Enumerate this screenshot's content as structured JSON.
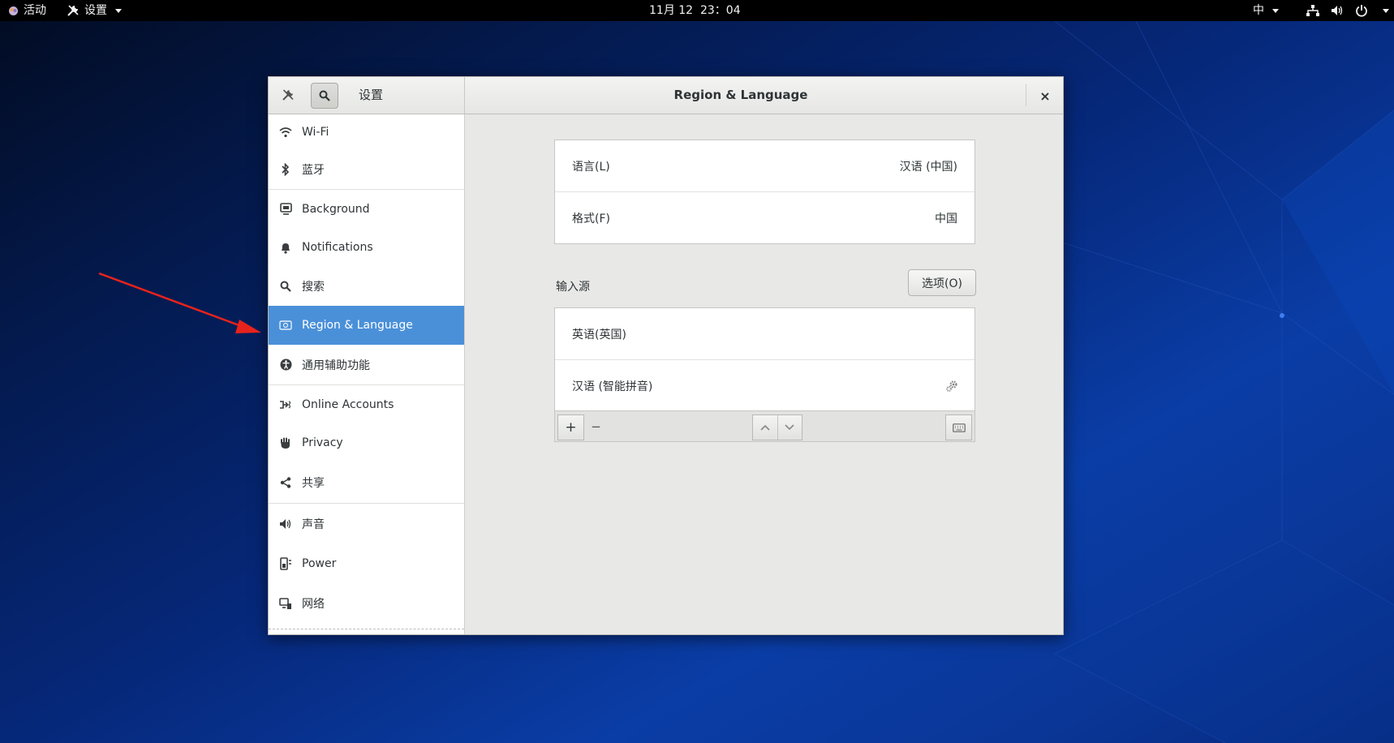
{
  "topbar": {
    "activities": "活动",
    "app_menu": "设置",
    "clock": "11月 12  23：04",
    "input_method": "中"
  },
  "window": {
    "sidebar_title": "设置",
    "page_title": "Region & Language",
    "close": "×"
  },
  "sidebar": {
    "items": [
      {
        "label": "Wi-Fi",
        "icon": "wifi-icon"
      },
      {
        "label": "蓝牙",
        "icon": "bluetooth-icon"
      },
      {
        "label": "Background",
        "icon": "background-icon"
      },
      {
        "label": "Notifications",
        "icon": "bell-icon"
      },
      {
        "label": "搜索",
        "icon": "search-icon"
      },
      {
        "label": "Region & Language",
        "icon": "region-icon",
        "active": true
      },
      {
        "label": "通用辅助功能",
        "icon": "accessibility-icon"
      },
      {
        "label": "Online Accounts",
        "icon": "online-accounts-icon"
      },
      {
        "label": "Privacy",
        "icon": "hand-icon"
      },
      {
        "label": "共享",
        "icon": "share-icon"
      },
      {
        "label": "声音",
        "icon": "speaker-icon"
      },
      {
        "label": "Power",
        "icon": "power-icon"
      },
      {
        "label": "网络",
        "icon": "network-icon"
      }
    ]
  },
  "region": {
    "language_label": "语言(L)",
    "language_value": "汉语 (中国)",
    "formats_label": "格式(F)",
    "formats_value": "中国",
    "input_sources_title": "输入源",
    "options_button": "选项(O)",
    "input_sources": [
      {
        "label": "英语(英国)"
      },
      {
        "label": "汉语 (智能拼音)",
        "has_settings": true
      }
    ],
    "add": "+",
    "remove": "−"
  },
  "colors": {
    "accent": "#4a90d9",
    "topbar": "#000000",
    "arrow": "#e8231c"
  }
}
